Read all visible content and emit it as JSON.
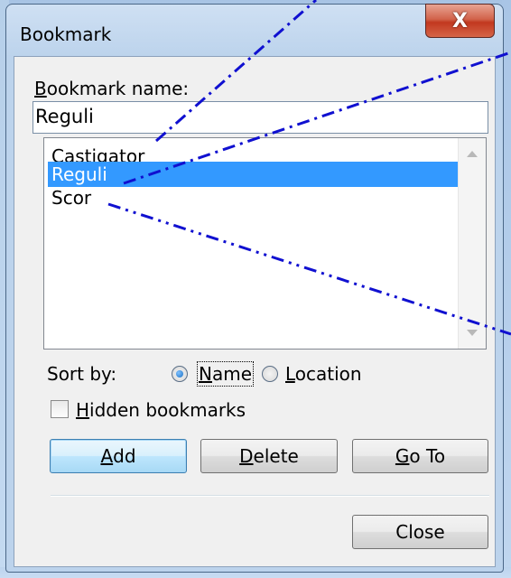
{
  "window": {
    "title": "Bookmark",
    "close_glyph": "X"
  },
  "bookmark_name": {
    "label_accel": "B",
    "label_rest": "ookmark name:",
    "value": "Reguli"
  },
  "list": {
    "items": [
      "Castigator",
      "Reguli",
      "Scor"
    ],
    "selected_index": 1
  },
  "sort": {
    "label": "Sort by:",
    "name_accel": "N",
    "name_rest": "ame",
    "location_accel": "L",
    "location_rest": "ocation",
    "selected": "Name"
  },
  "hidden_bookmarks": {
    "accel": "H",
    "rest": "idden bookmarks",
    "checked": false
  },
  "buttons": {
    "add_accel": "A",
    "add_rest": "dd",
    "delete_accel": "D",
    "delete_rest": "elete",
    "goto_accel": "G",
    "goto_rest": "o To",
    "close": "Close"
  },
  "colors": {
    "selection": "#3399ff",
    "callout_line": "#1010d0"
  }
}
